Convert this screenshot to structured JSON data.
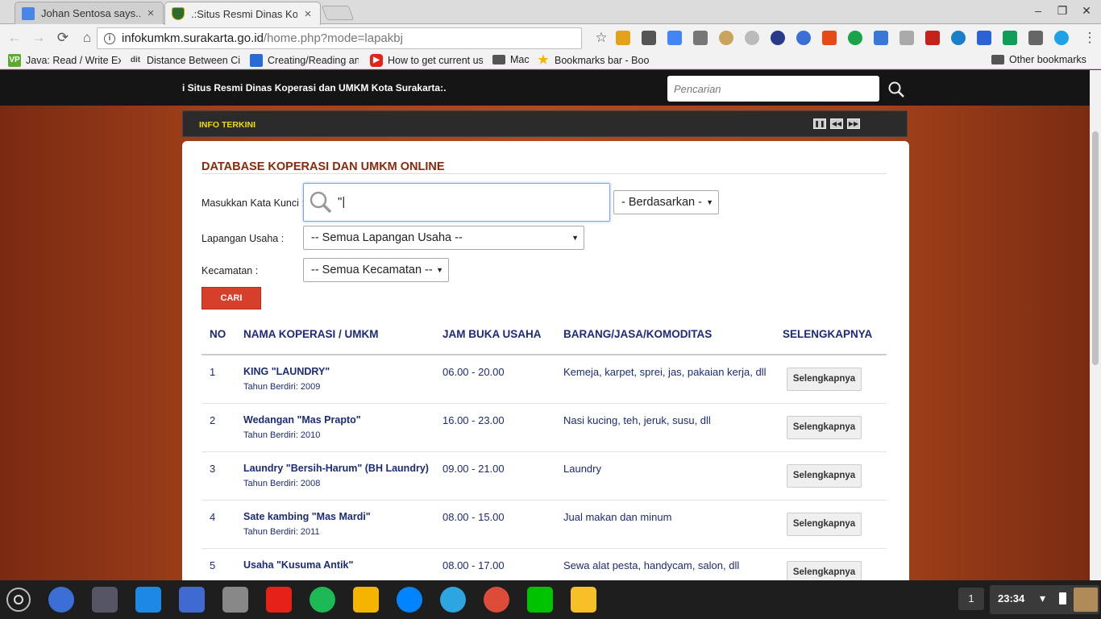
{
  "browser": {
    "tabs": [
      {
        "title": "Johan Sentosa says...",
        "close": "×"
      },
      {
        "title": ".:Situs Resmi Dinas Kope",
        "close": "×"
      }
    ],
    "url_host": "infokumkm.surakarta.go.id",
    "url_path": "/home.php?mode=lapakbj",
    "bookmarks": [
      {
        "label": "Java: Read / Write Ex",
        "icon": "VP"
      },
      {
        "label": "Distance Between Citi",
        "icon": "dit"
      },
      {
        "label": "Creating/Reading an",
        "icon": ""
      },
      {
        "label": "How to get current us",
        "icon": ""
      },
      {
        "label": "Mac",
        "icon": "folder"
      },
      {
        "label": "Bookmarks bar - Book",
        "icon": "star"
      }
    ],
    "other_bookmarks": "Other bookmarks"
  },
  "site": {
    "marquee": "i Situs Resmi Dinas Koperasi dan UMKM Kota Surakarta:.",
    "search_placeholder": "Pencarian",
    "info_label": "INFO TERKINI",
    "controls": [
      "pause",
      "rewind",
      "forward"
    ]
  },
  "form": {
    "title": "DATABASE KOPERASI DAN UMKM ONLINE",
    "keyword_label": "Masukkan Kata Kunci :",
    "keyword_value": "\"|",
    "berdasarkan": "- Berdasarkan -",
    "lapangan_label": "Lapangan Usaha :",
    "lapangan_value": "-- Semua Lapangan Usaha --",
    "kecamatan_label": "Kecamatan :",
    "kecamatan_value": "-- Semua Kecamatan --",
    "cari_label": "CARI"
  },
  "table": {
    "headers": [
      "NO",
      "NAMA KOPERASI / UMKM",
      "JAM BUKA USAHA",
      "BARANG/JASA/KOMODITAS",
      "SELENGKAPNYA"
    ],
    "rows": [
      {
        "no": "1",
        "name": "KING \"LAUNDRY\"",
        "year": "Tahun Berdiri: 2009",
        "jam": "06.00 - 20.00",
        "barang": "Kemeja, karpet, sprei, jas, pakaian kerja, dll",
        "more": "Selengkapnya"
      },
      {
        "no": "2",
        "name": "Wedangan \"Mas Prapto\"",
        "year": "Tahun Berdiri: 2010",
        "jam": "16.00 - 23.00",
        "barang": "Nasi kucing, teh, jeruk, susu, dll",
        "more": "Selengkapnya"
      },
      {
        "no": "3",
        "name": "Laundry \"Bersih-Harum\" (BH Laundry)",
        "year": "Tahun Berdiri: 2008",
        "jam": "09.00 - 21.00",
        "barang": "Laundry",
        "more": "Selengkapnya"
      },
      {
        "no": "4",
        "name": "Sate kambing \"Mas Mardi\"",
        "year": "Tahun Berdiri: 2011",
        "jam": "08.00 - 15.00",
        "barang": "Jual makan dan minum",
        "more": "Selengkapnya"
      },
      {
        "no": "5",
        "name": "Usaha \"Kusuma Antik\"",
        "year": "",
        "jam": "08.00 - 17.00",
        "barang": "Sewa alat pesta, handycam, salon, dll",
        "more": "Selengkapnya"
      }
    ]
  },
  "taskbar": {
    "notification_count": "1",
    "time": "23:34"
  }
}
